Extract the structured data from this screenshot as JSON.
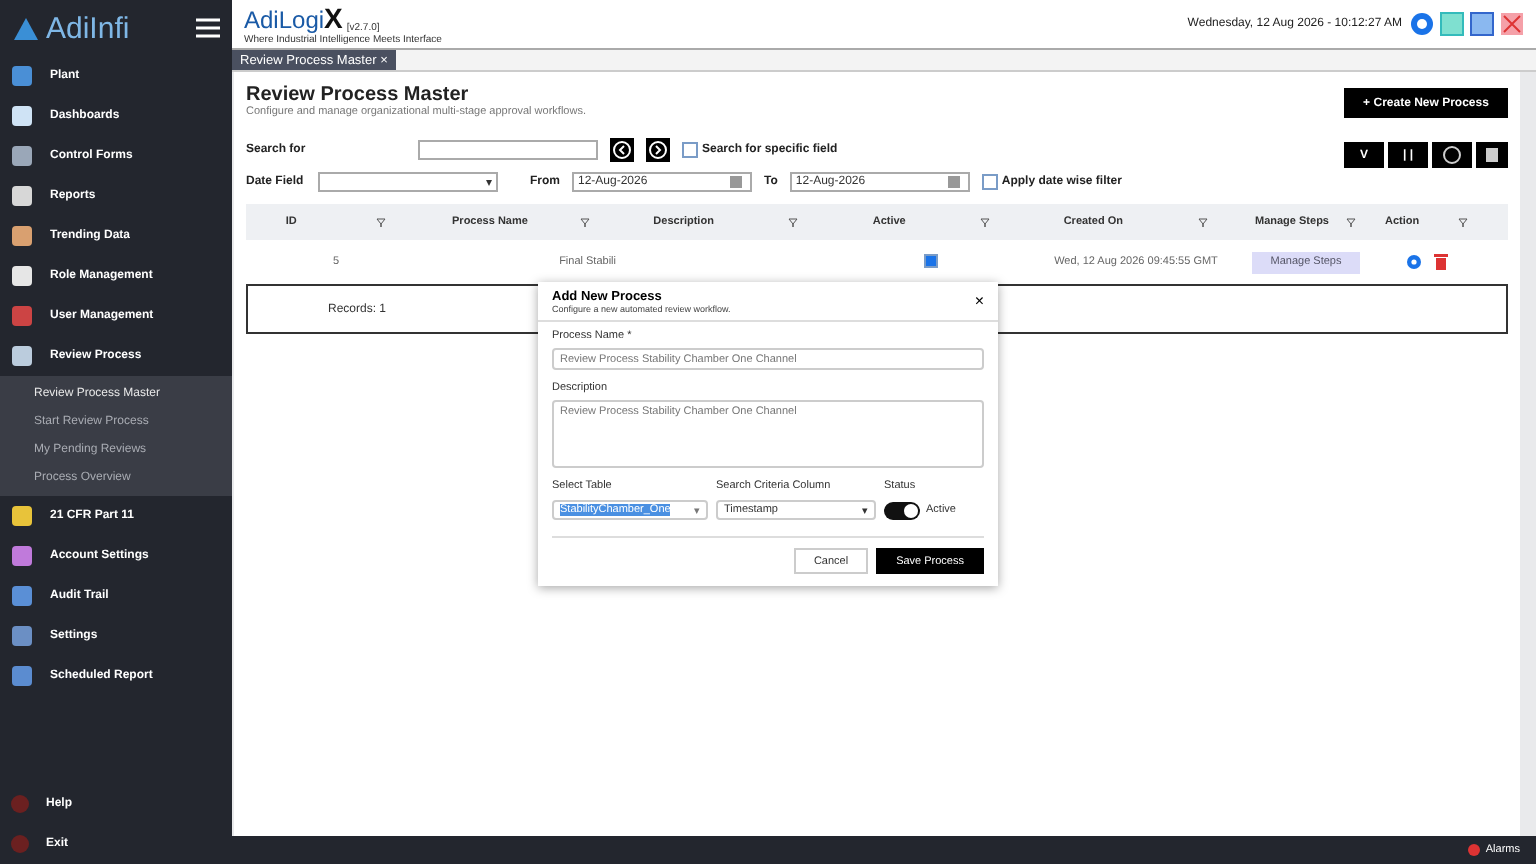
{
  "brand": {
    "logo": "AdiInfi",
    "app": "AdiLogi",
    "app_mark": "X",
    "version": "[v2.7.0]",
    "tagline": "Where Industrial Intelligence Meets Interface"
  },
  "header": {
    "datetime": "Wednesday, 12 Aug 2026 - 10:12:27 AM"
  },
  "sidebar": {
    "items": [
      {
        "label": "Plant"
      },
      {
        "label": "Dashboards"
      },
      {
        "label": "Control Forms"
      },
      {
        "label": "Reports"
      },
      {
        "label": "Trending Data"
      },
      {
        "label": "Role Management"
      },
      {
        "label": "User Management"
      },
      {
        "label": "Review Process",
        "children": [
          {
            "label": "Review Process Master",
            "selected": true
          },
          {
            "label": "Start Review Process",
            "selected": false
          },
          {
            "label": "My Pending Reviews",
            "selected": false
          },
          {
            "label": "Process Overview",
            "selected": false
          }
        ]
      },
      {
        "label": "21 CFR Part 11"
      },
      {
        "label": "Account Settings"
      },
      {
        "label": "Audit Trail"
      },
      {
        "label": "Settings"
      },
      {
        "label": "Scheduled Report"
      }
    ],
    "bottom": [
      "Help",
      "Exit"
    ]
  },
  "tab": {
    "label": "Review Process Master",
    "close": "×"
  },
  "page": {
    "title": "Review Process Master",
    "subtitle": "Configure and manage organizational multi-stage approval workflows.",
    "create_button": "Create New Process",
    "create_icon": "+"
  },
  "filters": {
    "search_label": "Search for",
    "date_caret": "▾",
    "specific_field": {
      "label": "Search for specific field",
      "checked": false
    },
    "date_label": "Date Field",
    "from_label": "From",
    "from": "12-Aug-2026",
    "to_label": "To",
    "to": "12-Aug-2026",
    "date_filter": {
      "label": "Apply date wise filter",
      "checked": false
    }
  },
  "toolbar": [
    "V",
    "| |"
  ],
  "table": {
    "columns": [
      "ID",
      "Process Name",
      "Description",
      "Active",
      "Created On",
      "Manage Steps",
      "Action"
    ],
    "rows": [
      {
        "id": "5",
        "name": "Final Stabili",
        "active": true,
        "created": "Wed, 12 Aug 2026 09:45:55 GMT",
        "manage": "Manage Steps"
      }
    ],
    "records": "Records: 1"
  },
  "dialog": {
    "title": "Add New Process",
    "subtitle": "Configure a new automated review workflow.",
    "close": "×",
    "name_label": "Process Name *",
    "name": "Review Process Stability Chamber One Channel",
    "desc_label": "Description",
    "desc": "Review Process Stability Chamber One Channel",
    "table_label": "Select Table",
    "table": "StabilityChamber_One",
    "table_caret": "▾",
    "column_label": "Search Criteria Column",
    "column": "Timestamp",
    "column_caret": "▾",
    "status_label": "Status",
    "status": {
      "label": "Active",
      "on": true
    },
    "cancel": "Cancel",
    "save": "Save Process"
  },
  "footer": {
    "alarms": "Alarms"
  }
}
